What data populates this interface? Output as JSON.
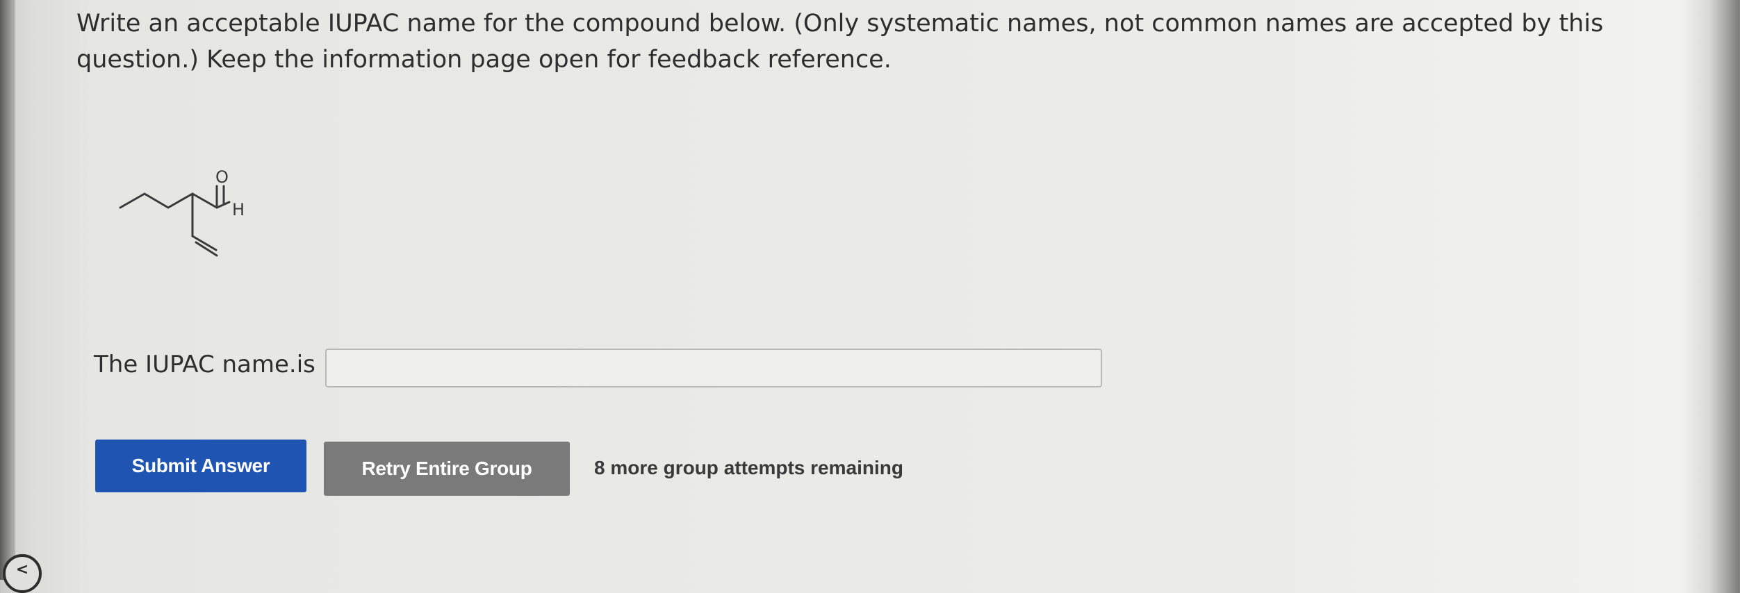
{
  "question": {
    "text": "Write an acceptable IUPAC name for the compound below. (Only systematic names, not common names are accepted by this question.) Keep the information page open for feedback reference."
  },
  "molecule": {
    "oxygen_label": "O",
    "hydrogen_label": "H"
  },
  "answer": {
    "label": "The IUPAC name.is",
    "value": "",
    "placeholder": ""
  },
  "buttons": {
    "submit_label": "Submit Answer",
    "retry_label": "Retry Entire Group"
  },
  "status": {
    "attempts_text": "8 more group attempts remaining"
  },
  "icons": {
    "corner": "chevron-left-icon",
    "corner_glyph": "<"
  },
  "colors": {
    "submit_bg": "#1f54b2",
    "retry_bg": "#7a7a7a",
    "text": "#2e2e2e"
  }
}
